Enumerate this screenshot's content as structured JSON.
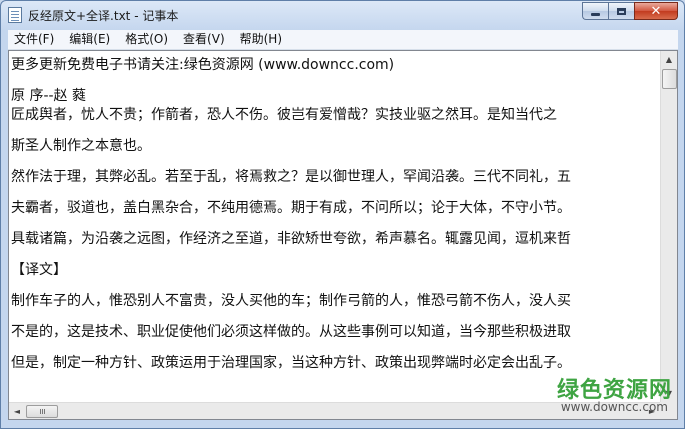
{
  "window": {
    "title": "反经原文+全译.txt - 记事本",
    "icon": "notepad-icon",
    "controls": {
      "minimize": "minimize-icon",
      "maximize": "maximize-icon",
      "close": "✕"
    }
  },
  "menu": {
    "items": [
      {
        "label": "文件(F)"
      },
      {
        "label": "编辑(E)"
      },
      {
        "label": "格式(O)"
      },
      {
        "label": "查看(V)"
      },
      {
        "label": "帮助(H)"
      }
    ]
  },
  "document": {
    "lines": [
      "更多更新免费电子书请关注:绿色资源网 (www.downcc.com)",
      "原 序--赵 蕤",
      "    匠成舆者，忧人不贵；作箭者，恐人不伤。彼岂有爱憎哉？实技业驱之然耳。是知当代之",
      "    斯圣人制作之本意也。",
      "    然作法于理，其弊必乱。若至于乱，将焉救之？是以御世理人，罕闻沿袭。三代不同礼，五",
      "    夫霸者，驳道也，盖白黑杂合，不纯用德焉。期于有成，不问所以；论于大体，不守小节。",
      "    具载诸篇，为沿袭之远图，作经济之至道，非欲矫世夸欲，希声慕名。辄露见闻，逗机来哲",
      "    【译文】",
      "    制作车子的人，惟恐别人不富贵，没人买他的车；制作弓箭的人，惟恐弓箭不伤人，没人买",
      "    不是的，这是技术、职业促使他们必须这样做的。从这些事例可以知道，当今那些积极进取",
      "    但是，制定一种方针、政策运用于治理国家，当这种方针、政策出现弊端时必定会出乱子。"
    ]
  },
  "scrollbars": {
    "up_arrow": "▲",
    "down_arrow": "▼",
    "left_arrow": "◄",
    "right_arrow": "►"
  },
  "watermark": {
    "title": "绿色资源网",
    "url": "www.downcc.com"
  },
  "colors": {
    "watermark_green": "#3fa443",
    "titlebar": "#c4d6ee",
    "close_button": "#c23b1f"
  }
}
